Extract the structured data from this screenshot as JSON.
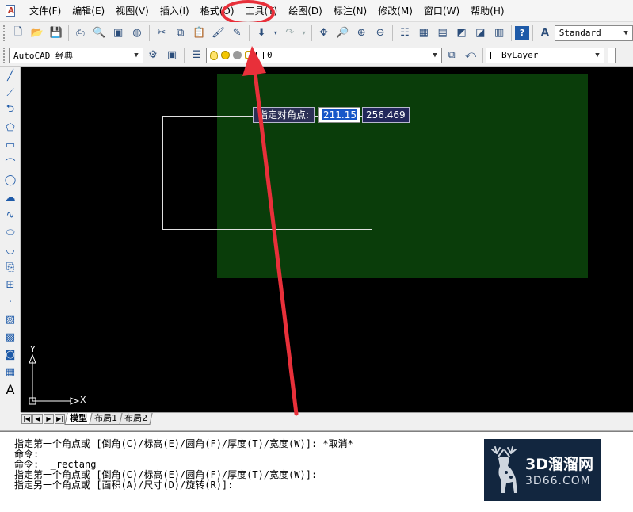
{
  "menubar": {
    "items": [
      "文件(F)",
      "编辑(E)",
      "视图(V)",
      "插入(I)",
      "格式(O)",
      "工具(T)",
      "绘图(D)",
      "标注(N)",
      "修改(M)",
      "窗口(W)",
      "帮助(H)"
    ]
  },
  "toolbar": {
    "text_style": "Standard",
    "workspace": "AutoCAD 经典",
    "layer": "0",
    "color": "ByLayer"
  },
  "canvas": {
    "dyn_prompt": "指定对角点:",
    "dyn_x": "211.15",
    "dyn_y": "256.469",
    "ucs_y": "Y",
    "ucs_x": "X"
  },
  "layout_tabs": [
    "模型",
    "布局1",
    "布局2"
  ],
  "command_lines": [
    "指定第一个角点或 [倒角(C)/标高(E)/圆角(F)/厚度(T)/宽度(W)]: *取消*",
    "命令:",
    "命令:  _rectang",
    "指定第一个角点或 [倒角(C)/标高(E)/圆角(F)/厚度(T)/宽度(W)]:",
    "指定另一个角点或 [面积(A)/尺寸(D)/旋转(R)]:"
  ],
  "watermark": {
    "main": "3D溜溜网",
    "sub": "3D66.COM"
  },
  "colors": {
    "canvas_bg": "#000000",
    "green_fill": "#0a3d0a",
    "highlight_red": "#e8303a",
    "watermark_bg": "#12263f"
  }
}
